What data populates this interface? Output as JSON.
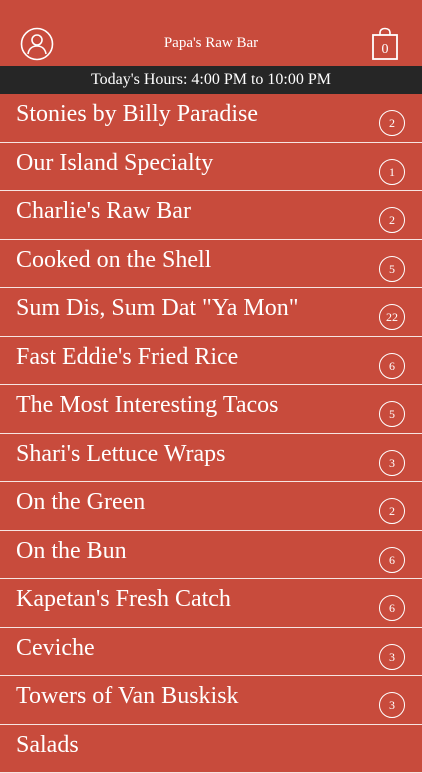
{
  "header": {
    "title": "Papa's Raw Bar",
    "profile_icon": "profile-icon",
    "cart_icon": "shopping-bag-icon",
    "cart_count": "0"
  },
  "hours": {
    "text": "Today's Hours: 4:00 PM to 10:00 PM"
  },
  "menu": {
    "categories": [
      {
        "label": "Stonies by Billy Paradise",
        "count": "2"
      },
      {
        "label": "Our Island Specialty",
        "count": "1"
      },
      {
        "label": "Charlie's Raw Bar",
        "count": "2"
      },
      {
        "label": "Cooked on the Shell",
        "count": "5"
      },
      {
        "label": "Sum Dis, Sum Dat \"Ya Mon\"",
        "count": "22"
      },
      {
        "label": "Fast Eddie's Fried Rice",
        "count": "6"
      },
      {
        "label": "The Most Interesting Tacos",
        "count": "5"
      },
      {
        "label": "Shari's Lettuce Wraps",
        "count": "3"
      },
      {
        "label": "On the Green",
        "count": "2"
      },
      {
        "label": "On the Bun",
        "count": "6"
      },
      {
        "label": "Kapetan's Fresh Catch",
        "count": "6"
      },
      {
        "label": "Ceviche",
        "count": "3"
      },
      {
        "label": "Towers of Van Buskisk",
        "count": "3"
      },
      {
        "label": "Salads",
        "count": ""
      }
    ]
  },
  "colors": {
    "background": "#c84b3c",
    "hours_bar": "#262626",
    "text": "#ffffff"
  }
}
